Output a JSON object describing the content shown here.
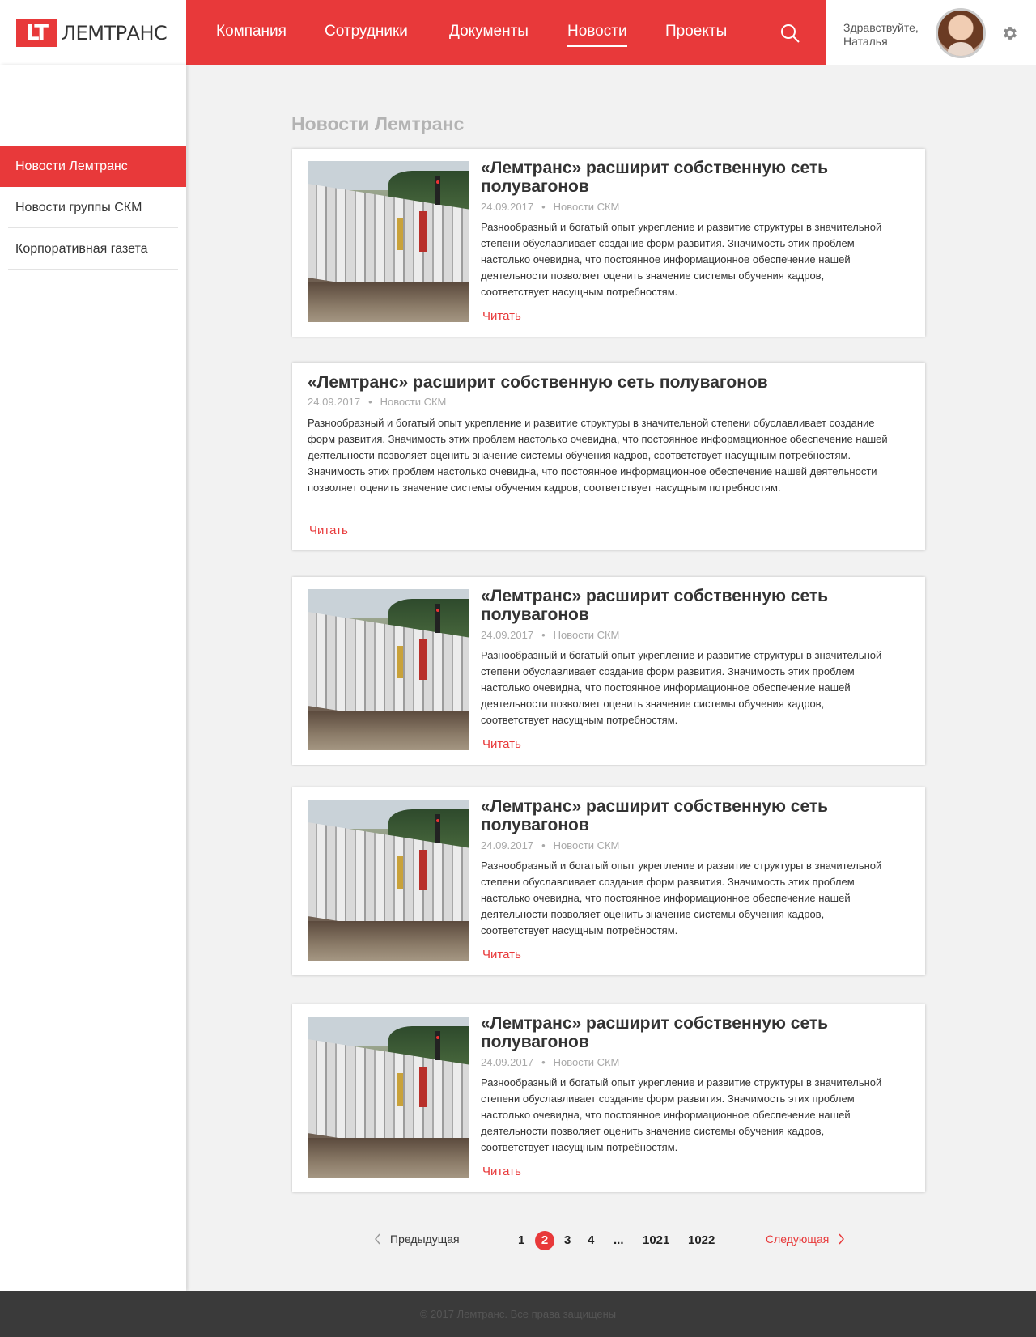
{
  "header": {
    "logo_mark": "LT",
    "logo_text": "ЛЕМТРАНС",
    "nav": [
      {
        "label": "Компания"
      },
      {
        "label": "Сотрудники"
      },
      {
        "label": "Документы"
      },
      {
        "label": "Новости"
      },
      {
        "label": "Проекты"
      }
    ],
    "active_nav": "Новости",
    "greeting_line1": "Здравствуйте,",
    "greeting_line2": "Наталья"
  },
  "sidebar": {
    "items": [
      {
        "label": "Новости Лемтранс"
      },
      {
        "label": "Новости группы СКМ"
      },
      {
        "label": "Корпоративная газета"
      }
    ]
  },
  "main": {
    "title": "Новости Лемтранс",
    "cards": [
      {
        "has_image": true,
        "title": "«Лемтранс» расширит собственную сеть полувагонов",
        "date": "24.09.2017",
        "dot": "•",
        "category": "Новости СКМ",
        "text": "Разнообразный и богатый опыт укрепление и развитие структуры в значительной степени обуславливает создание форм развития. Значимость этих проблем настолько очевидна, что постоянное информационное обеспечение нашей деятельности позволяет оценить значение системы обучения кадров, соответствует насущным потребностям.",
        "read": "Читать"
      },
      {
        "has_image": false,
        "title": "«Лемтранс» расширит собственную сеть полувагонов",
        "date": "24.09.2017",
        "dot": "•",
        "category": "Новости СКМ",
        "text": "Разнообразный и богатый опыт укрепление и развитие структуры в значительной степени обуславливает создание форм развития. Значимость этих проблем настолько очевидна, что постоянное информационное обеспечение нашей деятельности позволяет оценить значение системы обучения кадров, соответствует насущным потребностям. Значимость этих проблем настолько очевидна, что постоянное информационное обеспечение нашей деятельности позволяет оценить значение системы обучения кадров, соответствует насущным потребностям.",
        "read": "Читать"
      },
      {
        "has_image": true,
        "title": "«Лемтранс» расширит собственную сеть полувагонов",
        "date": "24.09.2017",
        "dot": "•",
        "category": "Новости СКМ",
        "text": "Разнообразный и богатый опыт укрепление и развитие структуры в значительной степени обуславливает создание форм развития. Значимость этих проблем настолько очевидна, что постоянное информационное обеспечение нашей деятельности позволяет оценить значение системы обучения кадров, соответствует насущным потребностям.",
        "read": "Читать"
      },
      {
        "has_image": true,
        "title": "«Лемтранс» расширит собственную сеть полувагонов",
        "date": "24.09.2017",
        "dot": "•",
        "category": "Новости СКМ",
        "text": "Разнообразный и богатый опыт укрепление и развитие структуры в значительной степени обуславливает создание форм развития. Значимость этих проблем настолько очевидна, что постоянное информационное обеспечение нашей деятельности позволяет оценить значение системы обучения кадров, соответствует насущным потребностям.",
        "read": "Читать"
      },
      {
        "has_image": true,
        "title": "«Лемтранс» расширит собственную сеть полувагонов",
        "date": "24.09.2017",
        "dot": "•",
        "category": "Новости СКМ",
        "text": "Разнообразный и богатый опыт укрепление и развитие структуры в значительной степени обуславливает создание форм развития. Значимость этих проблем настолько очевидна, что постоянное информационное обеспечение нашей деятельности позволяет оценить значение системы обучения кадров, соответствует насущным потребностям.",
        "read": "Читать"
      }
    ]
  },
  "pagination": {
    "prev": "Предыдущая",
    "next": "Следующая",
    "pages": [
      "1",
      "2",
      "3",
      "4",
      "...",
      "1021",
      "1022"
    ],
    "current": "2"
  },
  "footer": {
    "text": "© 2017 Лемтранс. Все права защищены"
  },
  "colors": {
    "accent": "#e8393a",
    "footer_bg": "#3a3a3a",
    "page_bg": "#f2f2f2"
  },
  "icons": {
    "search": "search-icon",
    "settings": "gear-icon",
    "prev": "chevron-left-icon",
    "next": "chevron-right-icon"
  }
}
